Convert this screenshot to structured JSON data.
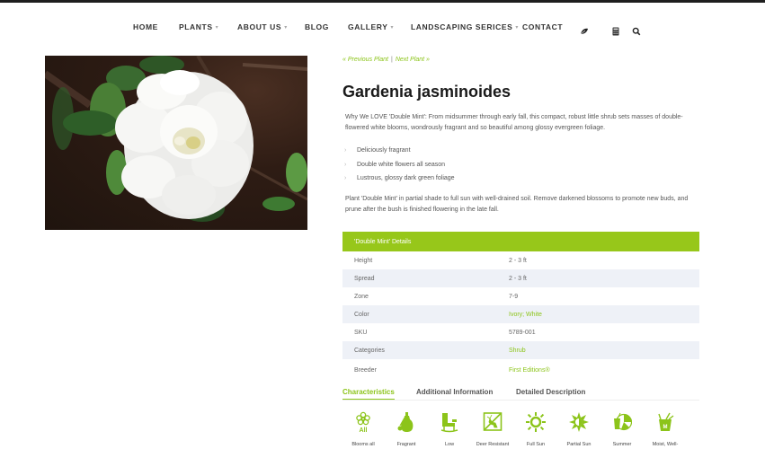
{
  "nav": {
    "items": [
      {
        "label": "HOME",
        "has_dropdown": false
      },
      {
        "label": "PLANTS",
        "has_dropdown": true
      },
      {
        "label": "ABOUT US",
        "has_dropdown": true
      },
      {
        "label": "BLOG",
        "has_dropdown": false
      },
      {
        "label": "GALLERY",
        "has_dropdown": true
      },
      {
        "label": "LANDSCAPING SERICES",
        "has_dropdown": true
      },
      {
        "label": "CONTACT",
        "has_dropdown": false
      }
    ],
    "caret": "▾",
    "icons": [
      "leaf-icon",
      "calculator-icon",
      "search-icon"
    ]
  },
  "hero": {
    "alt": "White double gardenia flower with glossy green leaves"
  },
  "pager": {
    "previous": "« Previous Plant",
    "separator": "|",
    "next": "Next Plant »"
  },
  "plant": {
    "title": "Gardenia jasminoides",
    "intro": "Why We LOVE 'Double Mint': From midsummer through early fall, this compact, robust little shrub sets masses of double-flowered white blooms, wondrously fragrant and so beautiful among glossy evergreen foliage.",
    "bullet_marker": "›",
    "bullets": [
      "Deliciously fragrant",
      "Double white flowers all season",
      "Lustrous, glossy dark green foliage"
    ],
    "care": "Plant 'Double Mint' in partial shade to full sun with well-drained soil. Remove darkened blossoms to promote new buds, and prune after the bush is finished flowering in the late fall."
  },
  "details": {
    "heading": "'Double Mint' Details",
    "rows": [
      {
        "key": "Height",
        "value": "2 - 3 ft",
        "link": false
      },
      {
        "key": "Spread",
        "value": "2 - 3 ft",
        "link": false
      },
      {
        "key": "Zone",
        "value": "7-9",
        "link": false
      },
      {
        "key": "Color",
        "value": "Ivory; White",
        "link": true
      },
      {
        "key": "SKU",
        "value": "5789-001",
        "link": false
      },
      {
        "key": "Categories",
        "value": "Shrub",
        "link": true
      },
      {
        "key": "Breeder",
        "value": "First Editions®",
        "link": true
      }
    ]
  },
  "tabs": [
    {
      "label": "Characteristics",
      "active": true
    },
    {
      "label": "Additional Information",
      "active": false
    },
    {
      "label": "Detailed Description",
      "active": false
    }
  ],
  "characteristics": [
    {
      "icon": "blooms-all-icon",
      "label": "Blooms all",
      "badge": "All"
    },
    {
      "icon": "fragrant-icon",
      "label": "Fragrant"
    },
    {
      "icon": "low-maintenance-icon",
      "label": "Low"
    },
    {
      "icon": "deer-resistant-icon",
      "label": "Deer Resistant"
    },
    {
      "icon": "full-sun-icon",
      "label": "Full Sun"
    },
    {
      "icon": "partial-sun-icon",
      "label": "Partial Sun"
    },
    {
      "icon": "summer-icon",
      "label": "Summer"
    },
    {
      "icon": "moist-well-drained-icon",
      "label": "Moist, Well-",
      "badge": "M"
    }
  ],
  "colors": {
    "accent": "#97c71a",
    "link": "#8cc41a",
    "alt_row": "#eef1f7",
    "topbar": "#1e1e1e"
  }
}
